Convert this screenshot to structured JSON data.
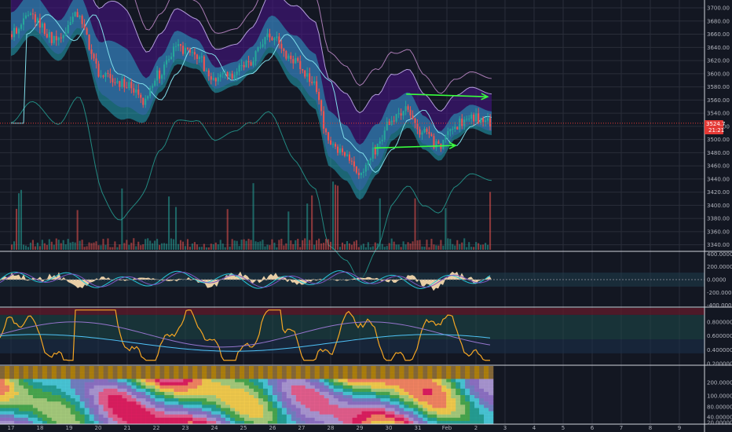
{
  "chart_data": {
    "type": "line",
    "colors": {
      "background": "#131722",
      "grid": "#2a2e39",
      "up": "#26a69a",
      "down": "#ef5350",
      "band_fill": "#26c6da",
      "cloud_fill": "#4a148c",
      "trend_arrow": "#39ff3d",
      "last_price_tag": "#e53935",
      "stoch_line": "#f5a623"
    },
    "main_pane": {
      "y_ticks": [
        "3700.00",
        "3680.00",
        "3660.00",
        "3640.00",
        "3620.00",
        "3600.00",
        "3580.00",
        "3560.00",
        "3540.00",
        "3520.00",
        "3500.00",
        "3480.00",
        "3460.00",
        "3440.00",
        "3420.00",
        "3400.00",
        "3380.00",
        "3360.00",
        "3340.00"
      ],
      "ylim": [
        3330,
        3712
      ],
      "last_price_label": "3524.7",
      "countdown_label": "21:21",
      "last_price": 3524.7,
      "trend_arrows": [
        {
          "from": [
            30.6,
            3569
          ],
          "to": [
            33.4,
            3565
          ]
        },
        {
          "from": [
            29.5,
            3487
          ],
          "to": [
            32.3,
            3491
          ]
        }
      ]
    },
    "osc1_pane": {
      "y_ticks": [
        "400.0000",
        "200.0000",
        "0.0000",
        "-200.0000",
        "-400.0000"
      ],
      "ylim": [
        -430,
        430
      ]
    },
    "osc2_pane": {
      "y_ticks": [
        "0.8000000",
        "0.6000000",
        "0.4000000",
        "0.2000000"
      ],
      "ylim": [
        0.18,
        1.0
      ]
    },
    "osc3_pane": {
      "y_ticks": [
        "200.0000000",
        "100.0000000",
        "80.0000000",
        "40.0000000",
        "20.0000000"
      ]
    },
    "x_ticks": [
      "17",
      "18",
      "19",
      "20",
      "21",
      "22",
      "23",
      "24",
      "25",
      "26",
      "27",
      "28",
      "29",
      "30",
      "31",
      "Feb",
      "2",
      "3",
      "4",
      "5",
      "6",
      "7",
      "8",
      "9"
    ]
  }
}
